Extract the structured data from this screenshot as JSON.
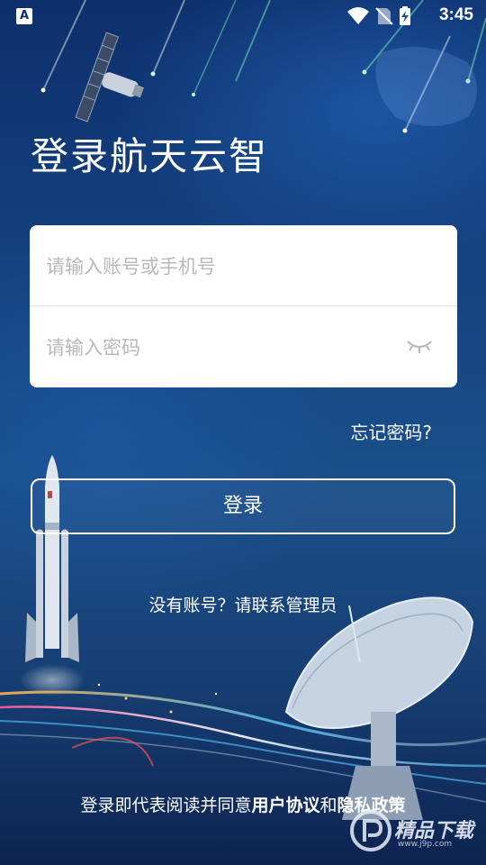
{
  "status_bar": {
    "left_icon": "A",
    "icons": [
      "wifi-icon",
      "no-sim-icon",
      "battery-charging-icon"
    ],
    "time": "3:45"
  },
  "app_title": "登录航天云智",
  "login_form": {
    "account_placeholder": "请输入账号或手机号",
    "password_placeholder": "请输入密码",
    "password_toggle_icon": "eye-closed-icon"
  },
  "forgot_password": "忘记密码?",
  "login_button": "登录",
  "no_account_text": "没有账号？请联系管理员",
  "agreement": {
    "prefix": "登录即代表阅读并同意",
    "user_agreement": "用户协议",
    "conjunction": "和",
    "privacy_policy": "隐私政策"
  },
  "watermark": {
    "text": "精品下载",
    "sub": "www.j9p.com"
  },
  "colors": {
    "background_top": "#0d2f6b",
    "background_bottom": "#0d2350",
    "card": "#ffffff",
    "placeholder": "#b8b8b8"
  }
}
